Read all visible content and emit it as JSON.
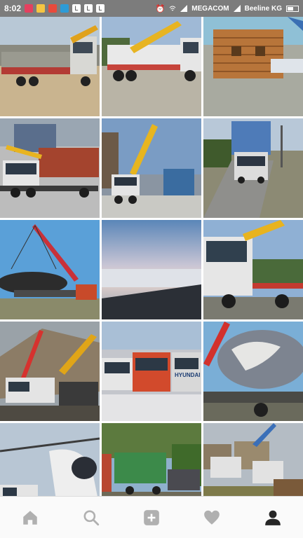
{
  "status_bar": {
    "time": "8:02",
    "carrier_left": "MEGACOM",
    "carrier_right": "Beeline KG",
    "notification_icons": [
      "instagram-icon",
      "gallery-icon",
      "download-icon",
      "app-icon",
      "l-icon",
      "l-icon",
      "l-icon"
    ],
    "letter_l": "L"
  },
  "grid": {
    "tiles": [
      {
        "subject": "flatbed-truck-crane"
      },
      {
        "subject": "truck-mounted-crane"
      },
      {
        "subject": "log-house"
      },
      {
        "subject": "truck-with-container"
      },
      {
        "subject": "crane-lifting-container"
      },
      {
        "subject": "truck-on-road"
      },
      {
        "subject": "crane-lifting-tank"
      },
      {
        "subject": "sky-view"
      },
      {
        "subject": "crane-truck-loaded"
      },
      {
        "subject": "crane-and-excavator"
      },
      {
        "subject": "truck-fleet",
        "label": "HYUNDAI"
      },
      {
        "subject": "crane-lifting-boulder"
      },
      {
        "subject": "helicopter-and-truck"
      },
      {
        "subject": "green-container-truck"
      },
      {
        "subject": "cranes-in-field"
      }
    ]
  },
  "nav": {
    "items": [
      "home-icon",
      "search-icon",
      "add-post-icon",
      "heart-icon",
      "profile-icon"
    ]
  },
  "colors": {
    "status_bar": "#7c7c7c",
    "nav_icon": "#b0b0b0",
    "nav_active": "#262626"
  }
}
